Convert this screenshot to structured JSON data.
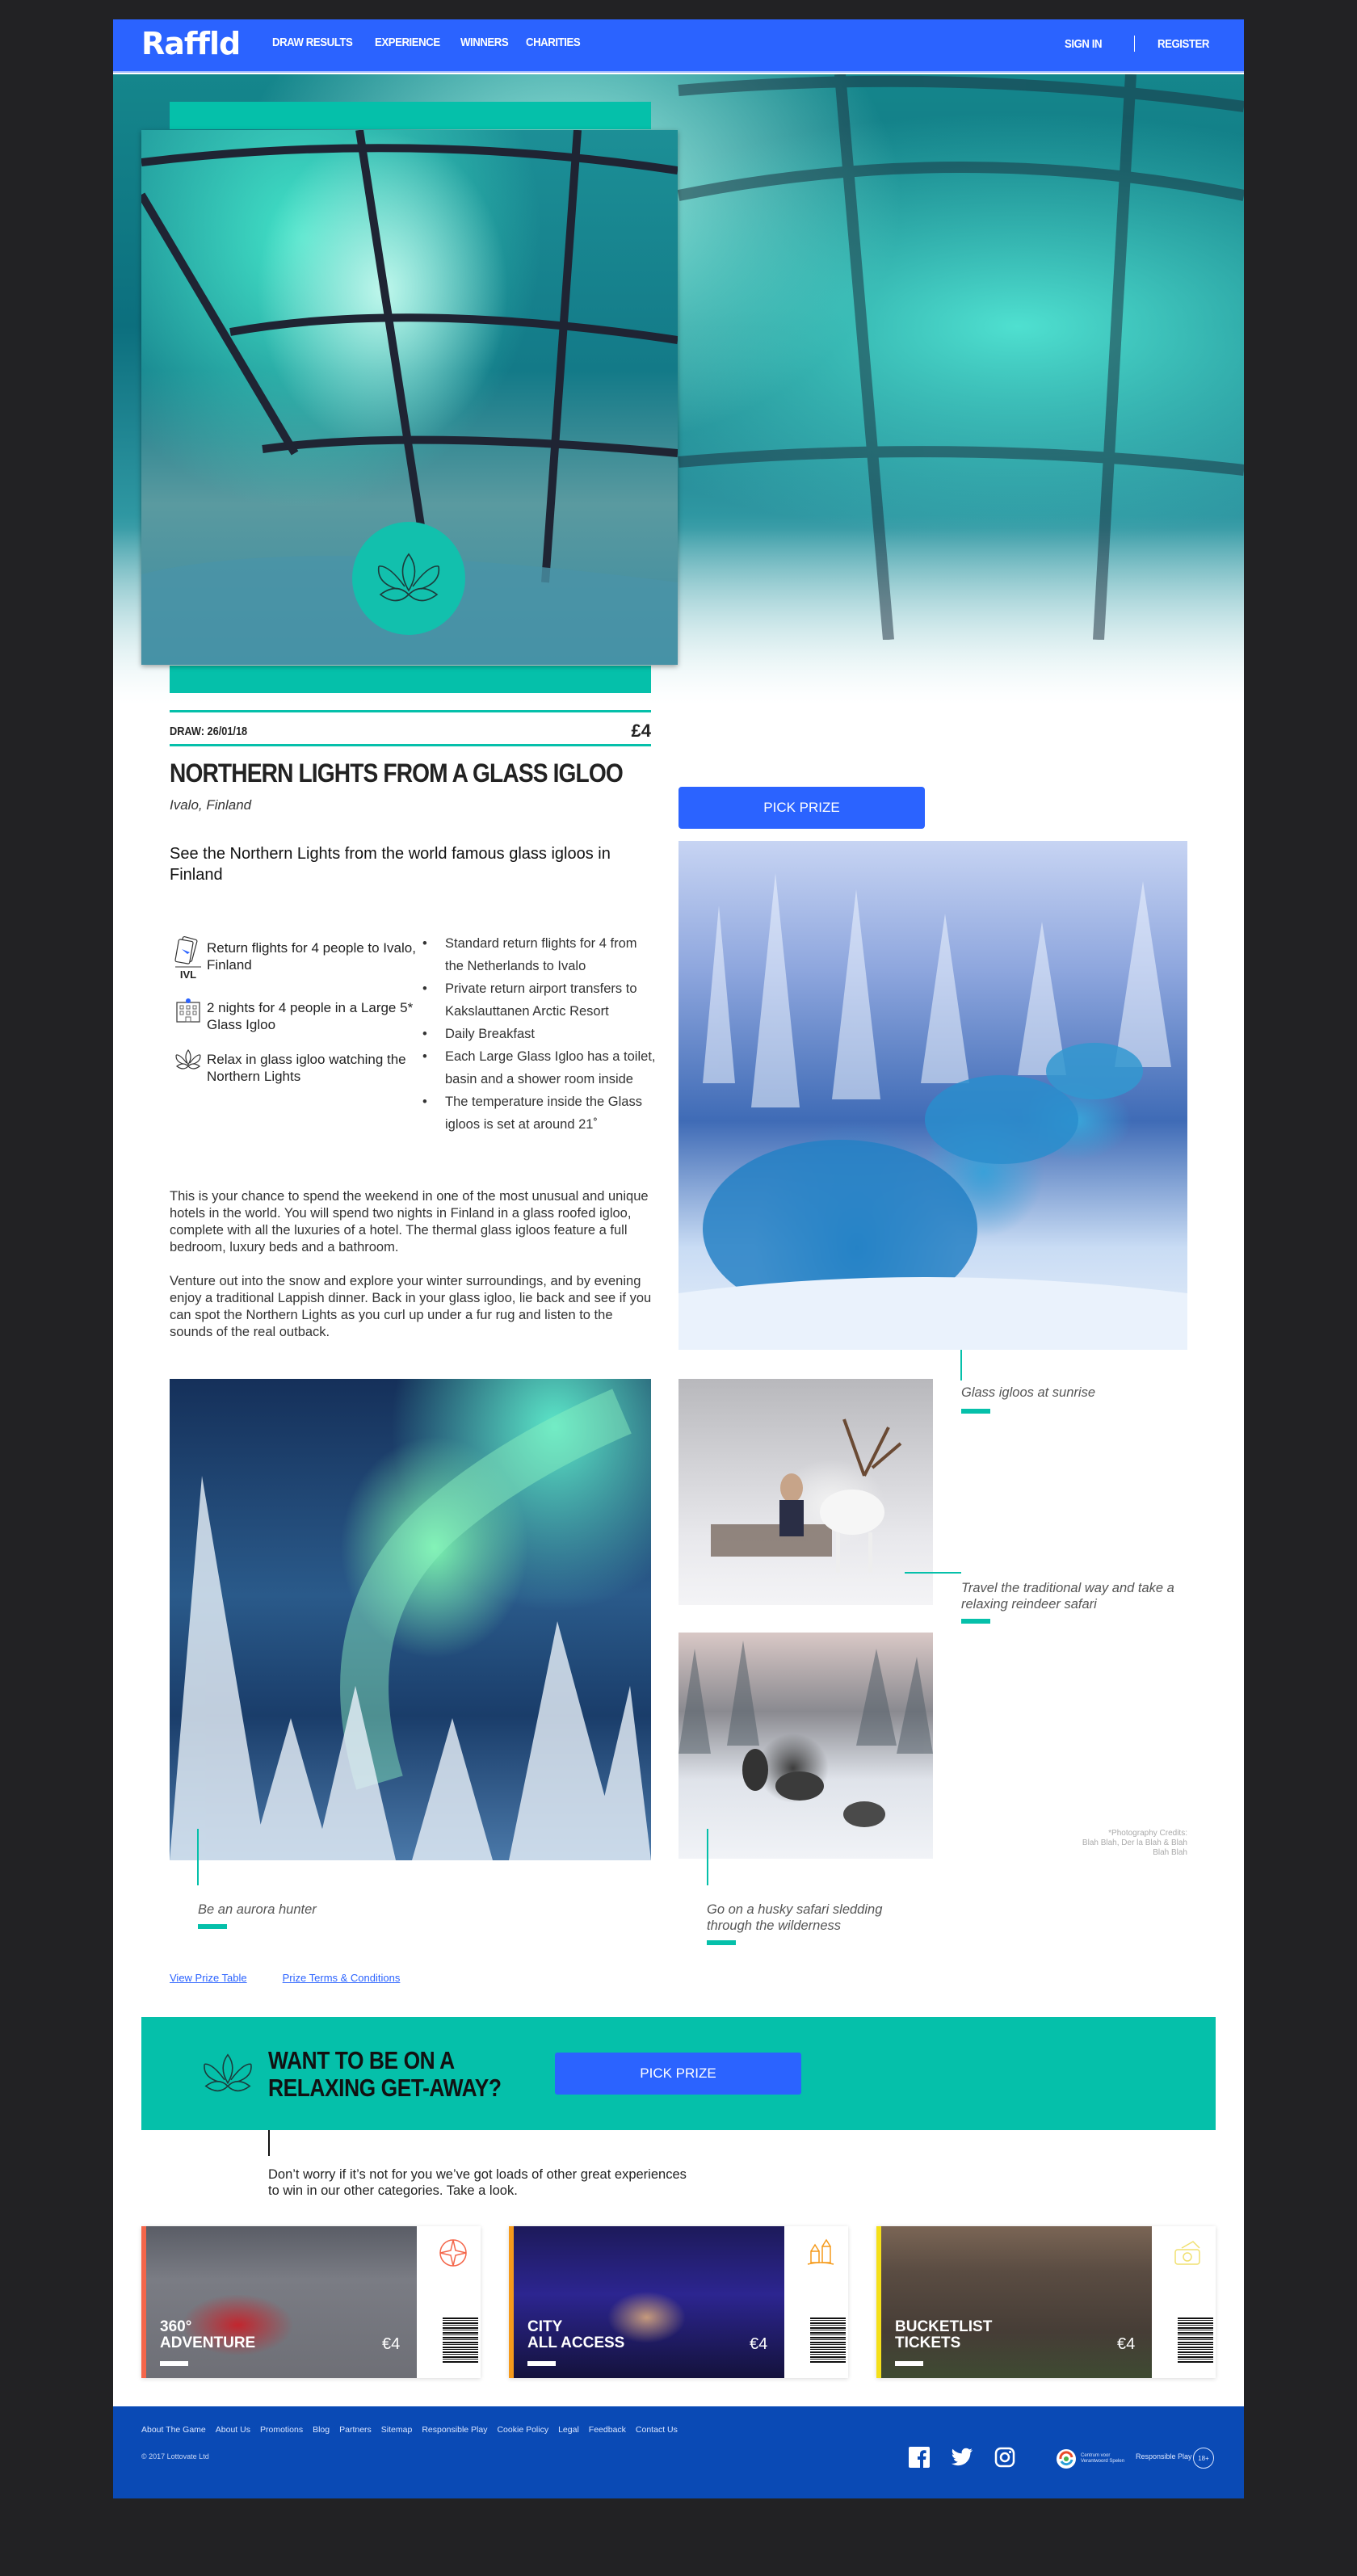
{
  "header": {
    "logo": "Raffld",
    "nav": [
      "DRAW RESULTS",
      "EXPERIENCE",
      "WINNERS",
      "CHARITIES"
    ],
    "sign_in": "SIGN IN",
    "register": "REGISTER"
  },
  "prize": {
    "draw_label": "DRAW: 26/01/18",
    "price": "£4",
    "title": "NORTHERN LIGHTS FROM A GLASS IGLOO",
    "location": "Ivalo, Finland",
    "subtitle": "See the Northern Lights from the world famous glass igloos in Finland",
    "pick_prize_label": "PICK PRIZE",
    "features": [
      {
        "icon": "plane-ticket-icon",
        "icon_label": "IVL",
        "text": "Return flights for 4 people to Ivalo, Finland"
      },
      {
        "icon": "hotel-icon",
        "text": "2 nights for 4 people in a Large 5* Glass Igloo"
      },
      {
        "icon": "lotus-icon",
        "text": "Relax in glass igloo watching the Northern Lights"
      }
    ],
    "bullets": [
      "Standard return flights for 4 from the Netherlands to Ivalo",
      "Private return airport transfers to Kakslauttanen Arctic Resort",
      "Daily Breakfast",
      "Each Large Glass Igloo has a toilet, basin and a shower room inside",
      "The temperature inside the Glass igloos is set at around 21˚"
    ],
    "description": [
      "This is your chance to spend the weekend in one of the most unusual and unique hotels in the world. You will spend two nights in Finland in a glass roofed igloo, complete with all the luxuries of a hotel. The thermal glass igloos feature a full bedroom, luxury beds and a bathroom.",
      "Venture out into the snow and explore your winter surroundings, and by evening enjoy a traditional Lappish dinner. Back in your glass igloo, lie back and see if you can spot the Northern Lights as you curl up under a fur rug and listen to the sounds of the real outback."
    ]
  },
  "gallery": {
    "captions": {
      "igloos": "Glass igloos at sunrise",
      "reindeer": "Travel the traditional way and take a relaxing reindeer safari",
      "aurora": "Be an aurora hunter",
      "husky": "Go on a husky safari sledding through the wilderness"
    },
    "credits": [
      "*Photography Credits:",
      "Blah Blah, Der la Blah & Blah",
      "Blah Blah"
    ]
  },
  "links": {
    "prize_table": "View Prize Table",
    "terms": "Prize Terms & Conditions"
  },
  "cta": {
    "heading_line1": "WANT TO BE ON A",
    "heading_line2": "RELAXING GET-AWAY?",
    "button": "PICK PRIZE",
    "note": "Don’t worry if it’s not for you we’ve got loads of other great experiences to win in our other categories. Take a look."
  },
  "tickets": [
    {
      "name": "360°\nADVENTURE",
      "price": "€4",
      "accent": "#f4664a",
      "icon": "compass-icon"
    },
    {
      "name": "CITY\nALL ACCESS",
      "price": "€4",
      "accent": "#f59a1b",
      "icon": "city-buildings-icon"
    },
    {
      "name": "BUCKETLIST\nTICKETS",
      "price": "€4",
      "accent": "#f5e01b",
      "icon": "tickets-icon"
    }
  ],
  "footer": {
    "links": [
      "About The Game",
      "About Us",
      "Promotions",
      "Blog",
      "Partners",
      "Sitemap",
      "Responsible Play",
      "Cookie Policy",
      "Legal",
      "Feedback",
      "Contact Us"
    ],
    "copyright": "© 2017 Lottovate Ltd",
    "cvs_line1": "Centrum voor",
    "cvs_line2": "Verantwoord Spelen",
    "responsible_play": "Responsible Play",
    "age_badge": "18+"
  },
  "colors": {
    "brand_blue": "#2b63ff",
    "teal": "#05c0aa",
    "footer_blue": "#0a4ab5"
  }
}
